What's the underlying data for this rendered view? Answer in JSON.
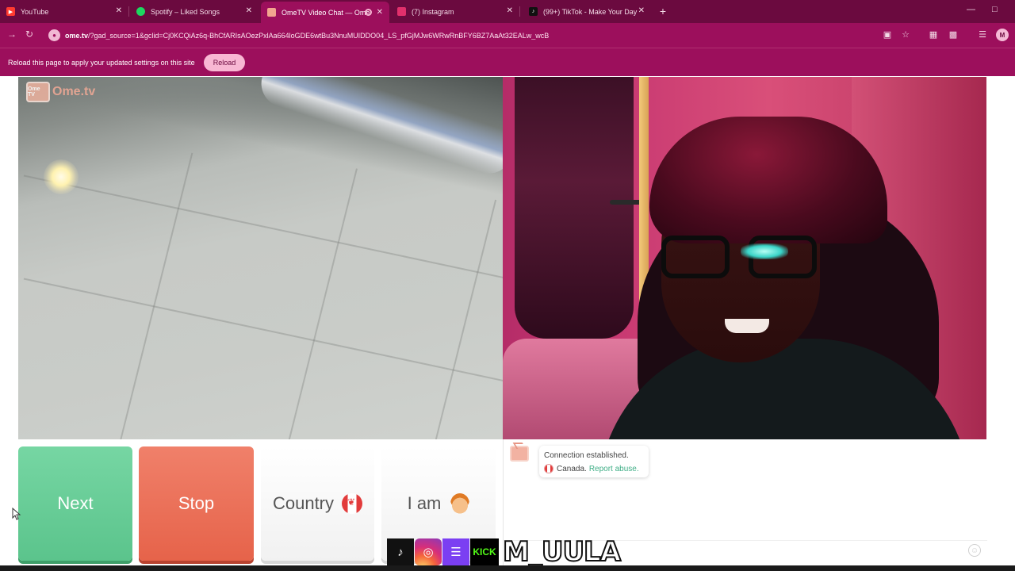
{
  "browser": {
    "tabs": [
      {
        "title": "YouTube",
        "icon": "youtube-icon",
        "color": "#ff3b30"
      },
      {
        "title": "Spotify – Liked Songs",
        "icon": "spotify-icon",
        "color": "#1ed760"
      },
      {
        "title": "OmeTV Video Chat — Ome",
        "icon": "ometv-icon",
        "color": "#f2a48f",
        "active": true
      },
      {
        "title": "(7) Instagram",
        "icon": "instagram-icon",
        "color": "#e1306c"
      },
      {
        "title": "(99+) TikTok - Make Your Day",
        "icon": "tiktok-icon",
        "color": "#111111"
      }
    ],
    "url_host": "ome.tv",
    "url_rest": "/?gad_source=1&gclid=Cj0KCQiAz6q-BhCfARIsAOezPxlAa664loGDE6wtBu3NnuMUIDDO04_LS_pfGjMJw6WRwRnBFY6BZ7AaAt32EALw_wcB",
    "profile_initial": "M",
    "accent": "#9c0f5c"
  },
  "infobar": {
    "message": "Reload this page to apply your updated settings on this site",
    "reload_label": "Reload"
  },
  "site": {
    "watermark_box": "Ome TV",
    "watermark_text": "Ome.tv"
  },
  "controls": {
    "next_label": "Next",
    "stop_label": "Stop",
    "country_label": "Country",
    "iam_label": "I am"
  },
  "chat": {
    "status_line": "Connection established.",
    "country": "Canada.",
    "report_link": "Report abuse.",
    "input_placeholder": ""
  },
  "overlay": {
    "tiktok": "♪",
    "instagram": "◎",
    "twitch": "☰",
    "kick": "KICK",
    "handle": "M_UULA"
  }
}
